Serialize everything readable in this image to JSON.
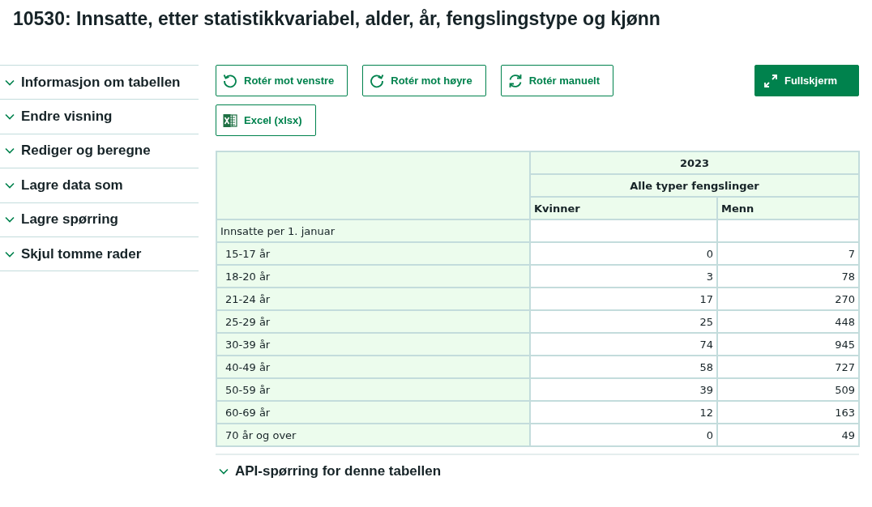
{
  "title": "10530: Innsatte, etter statistikkvariabel, alder, år, fengslingstype og kjønn",
  "sidebar": {
    "items": [
      {
        "label": "Informasjon om tabellen",
        "expanded": false
      },
      {
        "label": "Endre visning",
        "expanded": false
      },
      {
        "label": "Rediger og beregne",
        "expanded": false
      },
      {
        "label": "Lagre data som",
        "expanded": false
      },
      {
        "label": "Lagre spørring",
        "expanded": false
      },
      {
        "label": "Skjul tomme rader",
        "expanded": false
      }
    ]
  },
  "toolbar": {
    "buttons": [
      {
        "label": "Rotér mot venstre",
        "kind": "rotate-left"
      },
      {
        "label": "Rotér mot høyre",
        "kind": "rotate-right"
      },
      {
        "label": "Rotér manuelt",
        "kind": "rotate-both"
      }
    ],
    "fullscreen": {
      "label": "Fullskjerm"
    },
    "export": {
      "label": "Excel (xlsx)"
    }
  },
  "table": {
    "header": {
      "year": "2023",
      "type": "Alle typer fengslinger",
      "columns": [
        "Kvinner",
        "Menn"
      ]
    },
    "rows": [
      {
        "label": "Innsatte per 1. januar",
        "children": [
          {
            "label": "15-17 år",
            "values": [
              "0",
              "7"
            ]
          },
          {
            "label": "18-20 år",
            "values": [
              "3",
              "78"
            ]
          },
          {
            "label": "21-24 år",
            "values": [
              "17",
              "270"
            ]
          },
          {
            "label": "25-29 år",
            "values": [
              "25",
              "448"
            ]
          },
          {
            "label": "30-39 år",
            "values": [
              "74",
              "945"
            ]
          },
          {
            "label": "40-49 år",
            "values": [
              "58",
              "727"
            ]
          },
          {
            "label": "50-59 år",
            "values": [
              "39",
              "509"
            ]
          },
          {
            "label": "60-69 år",
            "values": [
              "12",
              "163"
            ]
          },
          {
            "label": "70 år og over",
            "values": [
              "0",
              "49"
            ]
          }
        ]
      }
    ]
  },
  "api_section": {
    "label": "API-spørring for denne tabellen",
    "expanded": false
  }
}
